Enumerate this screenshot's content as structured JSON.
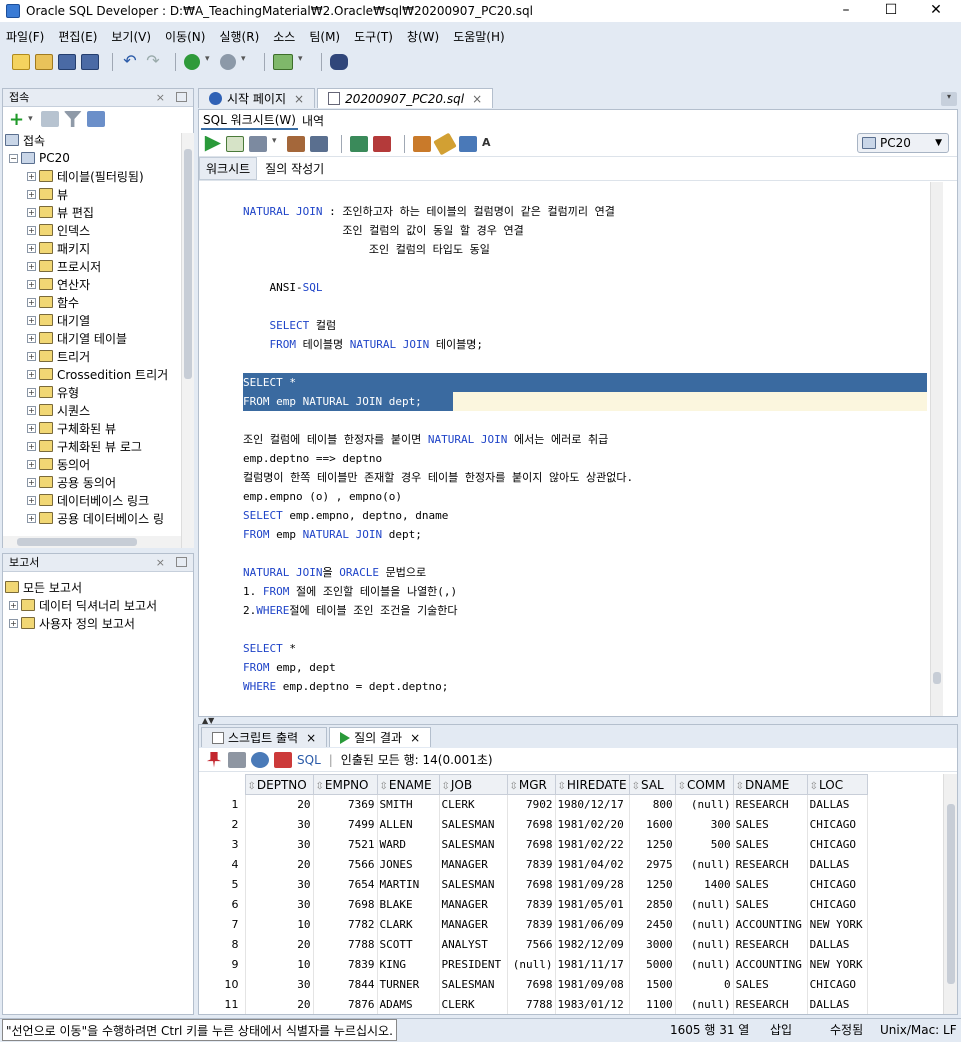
{
  "window": {
    "title": "Oracle SQL Developer : D:₩A_TeachingMaterial₩2.Oracle₩sql₩20200907_PC20.sql",
    "minimize": "–",
    "maximize": "☐",
    "close": "✕"
  },
  "menu": [
    "파일(F)",
    "편집(E)",
    "보기(V)",
    "이동(N)",
    "실행(R)",
    "소스",
    "팀(M)",
    "도구(T)",
    "창(W)",
    "도움말(H)"
  ],
  "connections": {
    "title": "접속",
    "root": "접속",
    "db": "PC20",
    "items": [
      "테이블(필터링됨)",
      "뷰",
      "뷰 편집",
      "인덱스",
      "패키지",
      "프로시저",
      "연산자",
      "함수",
      "대기열",
      "대기열 테이블",
      "트리거",
      "Crossedition 트리거",
      "유형",
      "시퀀스",
      "구체화된 뷰",
      "구체화된 뷰 로그",
      "동의어",
      "공용 동의어",
      "데이터베이스 링크",
      "공용 데이터베이스 링"
    ]
  },
  "reports": {
    "title": "보고서",
    "items": [
      "모든 보고서",
      "데이터 딕셔너리 보고서",
      "사용자 정의 보고서"
    ]
  },
  "doc_tabs": [
    "시작 페이지",
    "20200907_PC20.sql"
  ],
  "subtabs": [
    "SQL 워크시트(W)",
    "내역"
  ],
  "connection_select": "PC20",
  "editor_tabs": [
    "워크시트",
    "질의 작성기"
  ],
  "code_lines": [
    "NATURAL JOIN : 조인하고자 하는 테이블의 컬럼명이 같은 컬럼끼리 연결",
    "               조인 컬럼의 값이 동일 할 경우 연결",
    "                   조인 컬럼의 타입도 동일",
    "",
    "    ANSI-SQL",
    "",
    "    SELECT 컬럼",
    "    FROM 테이블명 NATURAL JOIN 테이블명;",
    "",
    "SELECT *",
    "FROM emp NATURAL JOIN dept;",
    "",
    "조인 컬럼에 테이블 한정자를 붙이면 NATURAL JOIN 에서는 에러로 취급",
    "emp.deptno ==> deptno",
    "컬럼명이 한쪽 테이블만 존재할 경우 테이블 한정자를 붙이지 않아도 상관없다.",
    "emp.empno (o) , empno(o)",
    "SELECT emp.empno, deptno, dname",
    "FROM emp NATURAL JOIN dept;",
    "",
    "NATURAL JOIN을 ORACLE 문법으로",
    "1. FROM 절에 조인할 테이블을 나열한(,)",
    "2.WHERE절에 테이블 조인 조건을 기술한다",
    "",
    "SELECT *",
    "FROM emp, dept",
    "WHERE emp.deptno = dept.deptno;"
  ],
  "result_tabs": [
    "스크립트 출력",
    "질의 결과"
  ],
  "result_info": "인출된 모든 행: 14(0.001초)",
  "sql_label": "SQL",
  "columns": [
    "DEPTNO",
    "EMPNO",
    "ENAME",
    "JOB",
    "MGR",
    "HIREDATE",
    "SAL",
    "COMM",
    "DNAME",
    "LOC"
  ],
  "rows": [
    [
      "1",
      "20",
      "7369",
      "SMITH",
      "CLERK",
      "7902",
      "1980/12/17",
      "800",
      "(null)",
      "RESEARCH",
      "DALLAS"
    ],
    [
      "2",
      "30",
      "7499",
      "ALLEN",
      "SALESMAN",
      "7698",
      "1981/02/20",
      "1600",
      "300",
      "SALES",
      "CHICAGO"
    ],
    [
      "3",
      "30",
      "7521",
      "WARD",
      "SALESMAN",
      "7698",
      "1981/02/22",
      "1250",
      "500",
      "SALES",
      "CHICAGO"
    ],
    [
      "4",
      "20",
      "7566",
      "JONES",
      "MANAGER",
      "7839",
      "1981/04/02",
      "2975",
      "(null)",
      "RESEARCH",
      "DALLAS"
    ],
    [
      "5",
      "30",
      "7654",
      "MARTIN",
      "SALESMAN",
      "7698",
      "1981/09/28",
      "1250",
      "1400",
      "SALES",
      "CHICAGO"
    ],
    [
      "6",
      "30",
      "7698",
      "BLAKE",
      "MANAGER",
      "7839",
      "1981/05/01",
      "2850",
      "(null)",
      "SALES",
      "CHICAGO"
    ],
    [
      "7",
      "10",
      "7782",
      "CLARK",
      "MANAGER",
      "7839",
      "1981/06/09",
      "2450",
      "(null)",
      "ACCOUNTING",
      "NEW YORK"
    ],
    [
      "8",
      "20",
      "7788",
      "SCOTT",
      "ANALYST",
      "7566",
      "1982/12/09",
      "3000",
      "(null)",
      "RESEARCH",
      "DALLAS"
    ],
    [
      "9",
      "10",
      "7839",
      "KING",
      "PRESIDENT",
      "(null)",
      "1981/11/17",
      "5000",
      "(null)",
      "ACCOUNTING",
      "NEW YORK"
    ],
    [
      "10",
      "30",
      "7844",
      "TURNER",
      "SALESMAN",
      "7698",
      "1981/09/08",
      "1500",
      "0",
      "SALES",
      "CHICAGO"
    ],
    [
      "11",
      "20",
      "7876",
      "ADAMS",
      "CLERK",
      "7788",
      "1983/01/12",
      "1100",
      "(null)",
      "RESEARCH",
      "DALLAS"
    ]
  ],
  "status": {
    "hint": "\"선언으로 이동\"을 수행하려면 Ctrl 키를 누른 상태에서 식별자를 누르십시오.",
    "position": "1605 행 31 열",
    "mode": "삽입",
    "modified": "수정됨",
    "eol": "Unix/Mac: LF"
  }
}
